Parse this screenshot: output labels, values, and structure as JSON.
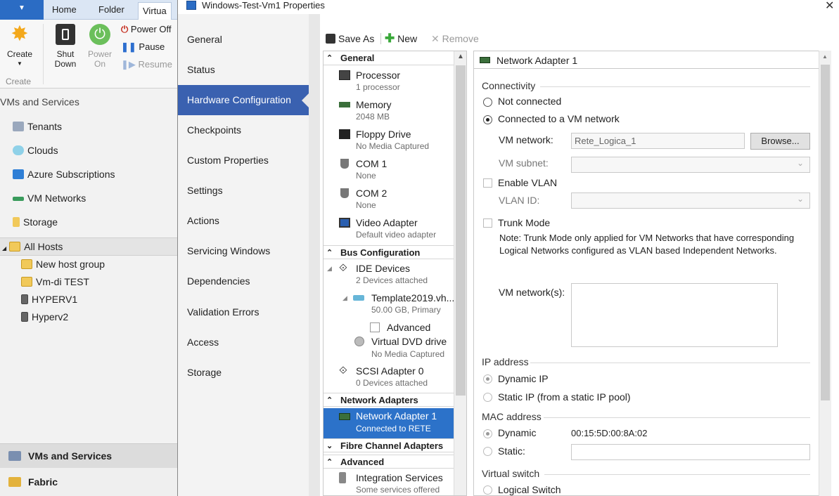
{
  "ribbon": {
    "tabs": [
      "Home",
      "Folder",
      "Virtua"
    ],
    "create_label": "Create",
    "create_group": "Create",
    "shut_down_label": [
      "Shut",
      "Down"
    ],
    "power_on_label": [
      "Power",
      "On"
    ],
    "power_off_label": "Power Off",
    "pause_label": "Pause",
    "resume_label": "Resume"
  },
  "console": {
    "section": "VMs and Services",
    "nav": [
      "Tenants",
      "Clouds",
      "Azure Subscriptions",
      "VM Networks",
      "Storage"
    ],
    "tree_root": "All Hosts",
    "tree_children": [
      "New host group",
      "Vm-di TEST",
      "HYPERV1",
      "Hyperv2"
    ],
    "workspaces": [
      "VMs and Services",
      "Fabric"
    ]
  },
  "dialog": {
    "title": "Windows-Test-Vm1 Properties",
    "close_glyph": "✕",
    "nav": [
      "General",
      "Status",
      "Hardware Configuration",
      "Checkpoints",
      "Custom Properties",
      "Settings",
      "Actions",
      "Servicing Windows",
      "Dependencies",
      "Validation Errors",
      "Access",
      "Storage"
    ],
    "active_nav": "Hardware Configuration",
    "toolbar": {
      "save_as": "Save As",
      "new": "New",
      "remove": "Remove"
    }
  },
  "tree": {
    "general_header": "General",
    "bus_header": "Bus Configuration",
    "network_header": "Network Adapters",
    "fibre_header": "Fibre Channel Adapters",
    "advanced_header": "Advanced",
    "processor": {
      "name": "Processor",
      "sub": "1 processor"
    },
    "memory": {
      "name": "Memory",
      "sub": "2048 MB"
    },
    "floppy": {
      "name": "Floppy Drive",
      "sub": "No Media Captured"
    },
    "com1": {
      "name": "COM 1",
      "sub": "None"
    },
    "com2": {
      "name": "COM 2",
      "sub": "None"
    },
    "video": {
      "name": "Video Adapter",
      "sub": "Default video adapter"
    },
    "ide": {
      "name": "IDE Devices",
      "sub": "2 Devices attached"
    },
    "vhd": {
      "name": "Template2019.vh...",
      "sub": "50.00 GB, Primary"
    },
    "vhd_advanced": "Advanced",
    "dvd": {
      "name": "Virtual DVD drive",
      "sub": "No Media Captured"
    },
    "scsi": {
      "name": "SCSI Adapter 0",
      "sub": "0 Devices attached"
    },
    "nic": {
      "name": "Network Adapter 1",
      "sub": "Connected to RETE"
    },
    "integration": {
      "name": "Integration Services",
      "sub": "Some services offered"
    }
  },
  "detail": {
    "header": "Network Adapter 1",
    "connectivity_group": "Connectivity",
    "not_connected": "Not connected",
    "connected_vm_network": "Connected to a VM network",
    "vm_network_label": "VM network:",
    "vm_network_value": "Rete_Logica_1",
    "browse_button": "Browse...",
    "vm_subnet_label": "VM subnet:",
    "enable_vlan": "Enable VLAN",
    "vlan_id_label": "VLAN ID:",
    "trunk_mode": "Trunk Mode",
    "trunk_note": "Note: Trunk Mode only applied for VM Networks that have corresponding Logical Networks configured as VLAN based Independent Networks.",
    "vm_networks_label": "VM network(s):",
    "ip_group": "IP address",
    "dynamic_ip": "Dynamic IP",
    "static_ip": "Static IP (from a static IP pool)",
    "mac_group": "MAC address",
    "mac_dynamic": "Dynamic",
    "mac_value": "00:15:5D:00:8A:02",
    "mac_static": "Static:",
    "vswitch_group": "Virtual switch",
    "logical_switch": "Logical Switch"
  },
  "colors": {
    "accent": "#3a61b0",
    "selection": "#2c72c9",
    "ribbon_file": "#2b6cc4"
  }
}
